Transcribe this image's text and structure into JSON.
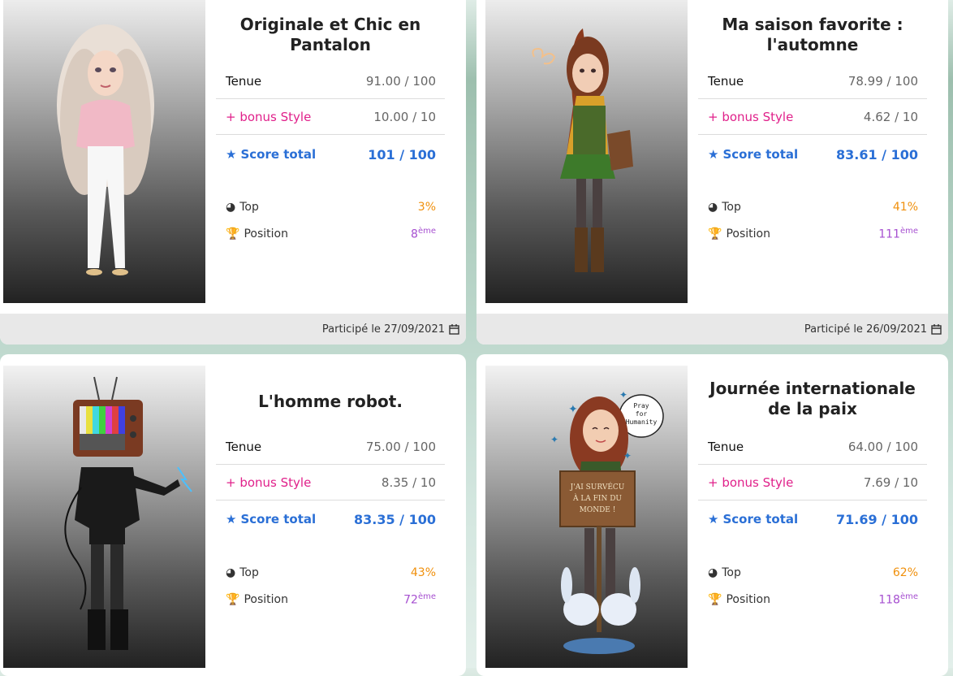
{
  "cards": [
    {
      "title": "Originale et Chic en Pantalon",
      "tenue_label": "Tenue",
      "tenue_value": "91.00 / 100",
      "bonus_label": "+ bonus Style",
      "bonus_value": "10.00 / 10",
      "score_label": "Score total",
      "score_value": "101 / 100",
      "top_label": "Top",
      "top_value": "3%",
      "position_label": "Position",
      "position_value": "8",
      "position_suffix": "ème",
      "footer": "Participé le 27/09/2021"
    },
    {
      "title": "Ma saison favorite : l'automne",
      "tenue_label": "Tenue",
      "tenue_value": "78.99 / 100",
      "bonus_label": "+ bonus Style",
      "bonus_value": "4.62 / 10",
      "score_label": "Score total",
      "score_value": "83.61 / 100",
      "top_label": "Top",
      "top_value": "41%",
      "position_label": "Position",
      "position_value": "111",
      "position_suffix": "ème",
      "footer": "Participé le 26/09/2021"
    },
    {
      "title": "L'homme robot.",
      "tenue_label": "Tenue",
      "tenue_value": "75.00 / 100",
      "bonus_label": "+ bonus Style",
      "bonus_value": "8.35 / 10",
      "score_label": "Score total",
      "score_value": "83.35 / 100",
      "top_label": "Top",
      "top_value": "43%",
      "position_label": "Position",
      "position_value": "72",
      "position_suffix": "ème"
    },
    {
      "title": "Journée internationale de la paix",
      "tenue_label": "Tenue",
      "tenue_value": "64.00 / 100",
      "bonus_label": "+ bonus Style",
      "bonus_value": "7.69 / 10",
      "score_label": "Score total",
      "score_value": "71.69 / 100",
      "top_label": "Top",
      "top_value": "62%",
      "position_label": "Position",
      "position_value": "118",
      "position_suffix": "ème",
      "bubble_text": "Pray for Humanity",
      "sign_text": "J'AI SURVÉCU À LA FIN DU MONDE !"
    }
  ],
  "colors": {
    "score": "#2a6fd6",
    "bonus": "#e0208a",
    "top": "#f0900c",
    "position": "#a64fd0"
  }
}
